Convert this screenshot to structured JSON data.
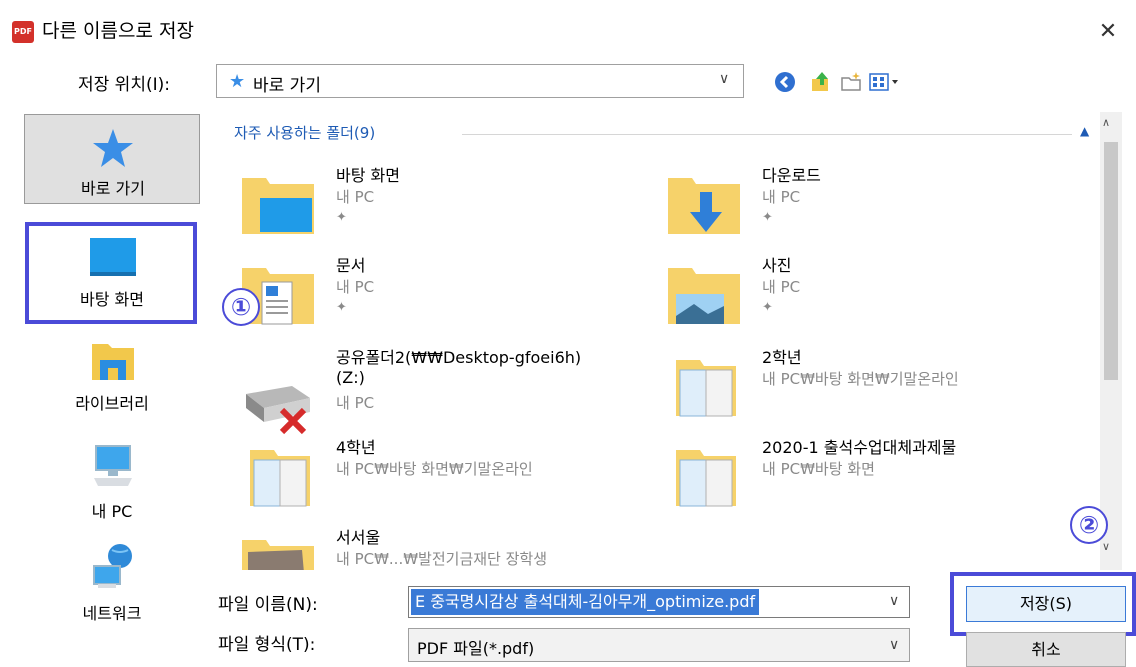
{
  "title_bar": {
    "app_badge": "PDF",
    "title": "다른 이름으로 저장",
    "close_glyph": "✕"
  },
  "location": {
    "label": "저장 위치(I):",
    "value": "바로 가기",
    "toolbar_icons": [
      "back-icon",
      "up-folder-icon",
      "new-folder-icon",
      "view-menu-icon"
    ]
  },
  "left_nav": [
    {
      "label": "바로 가기",
      "icon": "star-icon"
    },
    {
      "label": "바탕 화면",
      "icon": "desktop-icon"
    },
    {
      "label": "라이브러리",
      "icon": "library-icon"
    },
    {
      "label": "내 PC",
      "icon": "computer-icon"
    },
    {
      "label": "네트워크",
      "icon": "network-icon"
    }
  ],
  "group": {
    "header": "자주 사용하는 폴더(9)"
  },
  "items": [
    {
      "name": "바탕 화면",
      "sub": "내 PC",
      "pinned": true,
      "icon": "desktop-folder-icon"
    },
    {
      "name": "다운로드",
      "sub": "내 PC",
      "pinned": true,
      "icon": "downloads-folder-icon"
    },
    {
      "name": "문서",
      "sub": "내 PC",
      "pinned": true,
      "icon": "documents-folder-icon"
    },
    {
      "name": "사진",
      "sub": "내 PC",
      "pinned": true,
      "icon": "pictures-folder-icon"
    },
    {
      "name": "공유폴더2(₩₩Desktop-gfoei6h)",
      "name2": "(Z:)",
      "sub": "내 PC",
      "pinned": false,
      "icon": "network-drive-disconnected-icon"
    },
    {
      "name": "2학년",
      "sub": "내 PC₩바탕 화면₩기말온라인",
      "pinned": false,
      "icon": "folder-icon"
    },
    {
      "name": "4학년",
      "sub": "내 PC₩바탕 화면₩기말온라인",
      "pinned": false,
      "icon": "folder-icon"
    },
    {
      "name": "2020-1 출석수업대체과제물",
      "sub": "내 PC₩바탕 화면",
      "pinned": false,
      "icon": "folder-icon"
    },
    {
      "name": "서서울",
      "sub": "내 PC₩...₩발전기금재단 장학생",
      "pinned": false,
      "icon": "folder-icon"
    }
  ],
  "pin_glyph": "📌",
  "filename": {
    "label": "파일 이름(N):",
    "value": "E 중국명시감상 출석대체-김아무개_optimize.pdf"
  },
  "filetype": {
    "label": "파일 형식(T):",
    "value": "PDF 파일(*.pdf)"
  },
  "buttons": {
    "save": "저장(S)",
    "cancel": "취소"
  },
  "annotations": {
    "marker1": "①",
    "marker2": "②"
  },
  "colors": {
    "accent": "#4b4bd8",
    "selection": "#3a7ad6",
    "group_header": "#1e5bb4"
  }
}
